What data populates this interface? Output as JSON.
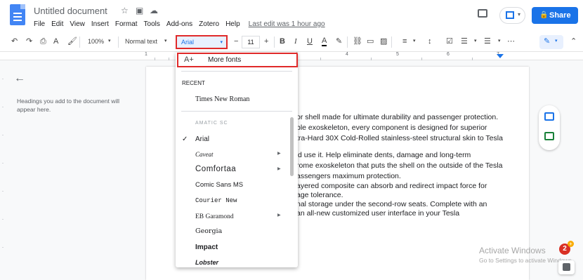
{
  "header": {
    "doc_title": "Untitled document",
    "menus": [
      "File",
      "Edit",
      "View",
      "Insert",
      "Format",
      "Tools",
      "Add-ons",
      "Zotero",
      "Help"
    ],
    "last_edit": "Last edit was 1 hour ago",
    "share_label": "Share"
  },
  "toolbar": {
    "zoom": "100%",
    "style": "Normal text",
    "font": "Arial",
    "font_size": "11"
  },
  "ruler": {
    "numbers": [
      "1",
      "1",
      "2",
      "3",
      "4",
      "5",
      "6",
      "7"
    ]
  },
  "outline": {
    "hint": "Headings you add to the document will appear here."
  },
  "document": {
    "lines": [
      "or shell made for ultimate durability and passenger protection.",
      "ble exoskeleton, every component is designed for superior",
      "tra-Hard 30X Cold-Rolled stainless-steel structural skin to Tesla",
      "'d use it. Help eliminate dents, damage and long-term",
      "rome exoskeleton that puts the shell on the outside of the Tesla",
      "assengers maximum protection.",
      "ayered composite can absorb and redirect impact force for",
      "age tolerance.",
      "nal storage under the second-row seats. Complete with an",
      "an all-new customized user interface in your Tesla"
    ]
  },
  "font_menu": {
    "more_fonts": "More fonts",
    "recent_heading": "RECENT",
    "recent": [
      "Times New Roman"
    ],
    "fonts": [
      "AMATIC SC",
      "Arial",
      "Caveat",
      "Comfortaa",
      "Comic Sans MS",
      "Courier New",
      "EB Garamond",
      "Georgia",
      "Impact",
      "Lobster"
    ],
    "selected": "Arial"
  },
  "windows": {
    "activate_title": "Activate Windows",
    "activate_sub": "Go to Settings to activate Windows.",
    "notification_count": "2"
  }
}
